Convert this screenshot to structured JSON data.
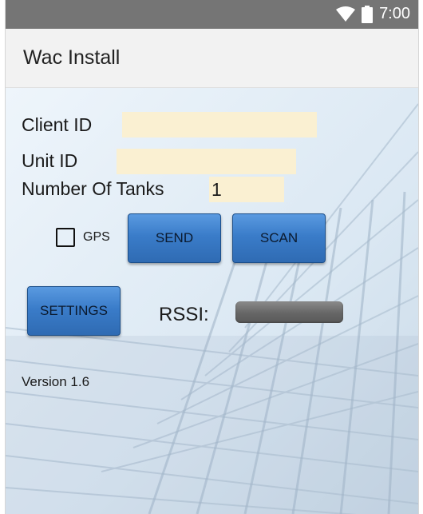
{
  "status_bar": {
    "time": "7:00"
  },
  "app_bar": {
    "title": "Wac Install"
  },
  "form": {
    "client_id": {
      "label": "Client ID",
      "value": ""
    },
    "unit_id": {
      "label": "Unit ID",
      "value": ""
    },
    "tanks": {
      "label": "Number Of Tanks",
      "value": "1"
    },
    "gps": {
      "label": "GPS",
      "checked": false
    }
  },
  "buttons": {
    "send": "SEND",
    "scan": "SCAN",
    "settings": "SETTINGS"
  },
  "rssi": {
    "label": "RSSI:"
  },
  "footer": {
    "version": "Version 1.6"
  },
  "colors": {
    "status_bar": "#757575",
    "app_bar": "#f2f2f2",
    "field_bg": "#faf0d2",
    "button": "#3a7cc9"
  }
}
